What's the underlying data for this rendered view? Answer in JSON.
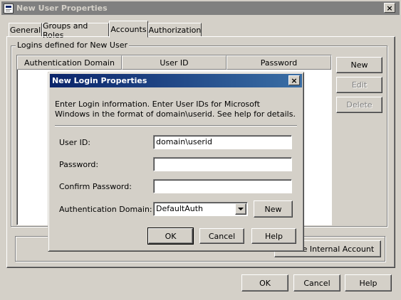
{
  "main_window": {
    "title": "New User Properties",
    "close_glyph": "×",
    "tabs": [
      {
        "label": "General"
      },
      {
        "label": "Groups and Roles"
      },
      {
        "label": "Accounts"
      },
      {
        "label": "Authorization"
      }
    ],
    "active_tab": "Accounts",
    "logins_group_label": "Logins defined for New User",
    "table_columns": [
      "Authentication Domain",
      "User ID",
      "Password"
    ],
    "side_buttons": {
      "new": "New",
      "edit": "Edit",
      "delete": "Delete"
    },
    "create_internal_account_label": "Create Internal Account",
    "footer_buttons": {
      "ok": "OK",
      "cancel": "Cancel",
      "help": "Help"
    }
  },
  "dialog": {
    "title": "New Login Properties",
    "close_glyph": "×",
    "instructions": "Enter Login information. Enter User IDs for Microsoft Windows in the format of domain\\userid. See help for details.",
    "fields": {
      "user_id_label": "User ID:",
      "user_id_value": "domain\\userid",
      "password_label": "Password:",
      "password_value": "",
      "confirm_password_label": "Confirm Password:",
      "confirm_password_value": "",
      "auth_domain_label": "Authentication Domain:",
      "auth_domain_value": "DefaultAuth",
      "new_button": "New"
    },
    "buttons": {
      "ok": "OK",
      "cancel": "Cancel",
      "help": "Help"
    }
  },
  "colors": {
    "face": "#d4d0c8",
    "titlebar_inactive": "#808080",
    "titlebar_active": "#0a246a"
  }
}
